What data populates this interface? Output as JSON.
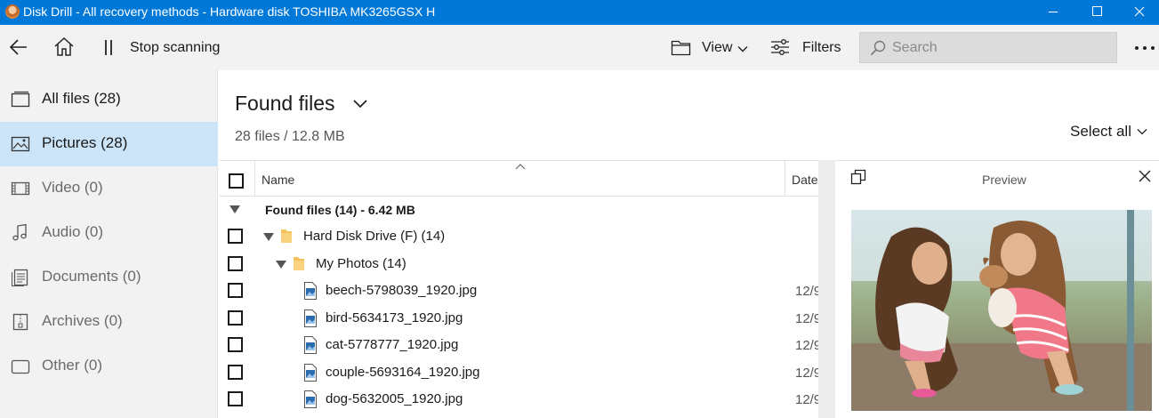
{
  "window": {
    "title": "Disk Drill - All recovery methods - Hardware disk TOSHIBA MK3265GSX H"
  },
  "toolbar": {
    "stop_label": "Stop scanning",
    "view_label": "View",
    "filters_label": "Filters",
    "search_placeholder": "Search"
  },
  "sidebar": {
    "items": [
      {
        "label": "All files (28)",
        "icon": "all-files-icon"
      },
      {
        "label": "Pictures (28)",
        "icon": "pictures-icon"
      },
      {
        "label": "Video (0)",
        "icon": "video-icon"
      },
      {
        "label": "Audio (0)",
        "icon": "audio-icon"
      },
      {
        "label": "Documents (0)",
        "icon": "documents-icon"
      },
      {
        "label": "Archives (0)",
        "icon": "archives-icon"
      },
      {
        "label": "Other (0)",
        "icon": "other-icon"
      }
    ],
    "active_index": 1
  },
  "main": {
    "title": "Found files",
    "subtitle": "28 files / 12.8 MB",
    "select_all": "Select all"
  },
  "table": {
    "columns": {
      "name": "Name",
      "date": "Date"
    },
    "group": {
      "label": "Found files (14) - 6.42 MB"
    },
    "rows": [
      {
        "type": "folder",
        "label": "Hard Disk Drive (F) (14)",
        "date": ""
      },
      {
        "type": "folder",
        "label": "My Photos (14)",
        "date": ""
      },
      {
        "type": "file",
        "label": "beech-5798039_1920.jpg",
        "date": "12/9"
      },
      {
        "type": "file",
        "label": "bird-5634173_1920.jpg",
        "date": "12/9"
      },
      {
        "type": "file",
        "label": "cat-5778777_1920.jpg",
        "date": "12/9"
      },
      {
        "type": "file",
        "label": "couple-5693164_1920.jpg",
        "date": "12/9"
      },
      {
        "type": "file",
        "label": "dog-5632005_1920.jpg",
        "date": "12/9"
      }
    ]
  },
  "preview": {
    "title": "Preview"
  },
  "colors": {
    "titlebar": "#0078d7",
    "active_sidebar": "#cce4f7",
    "folder": "#f4c25a"
  }
}
